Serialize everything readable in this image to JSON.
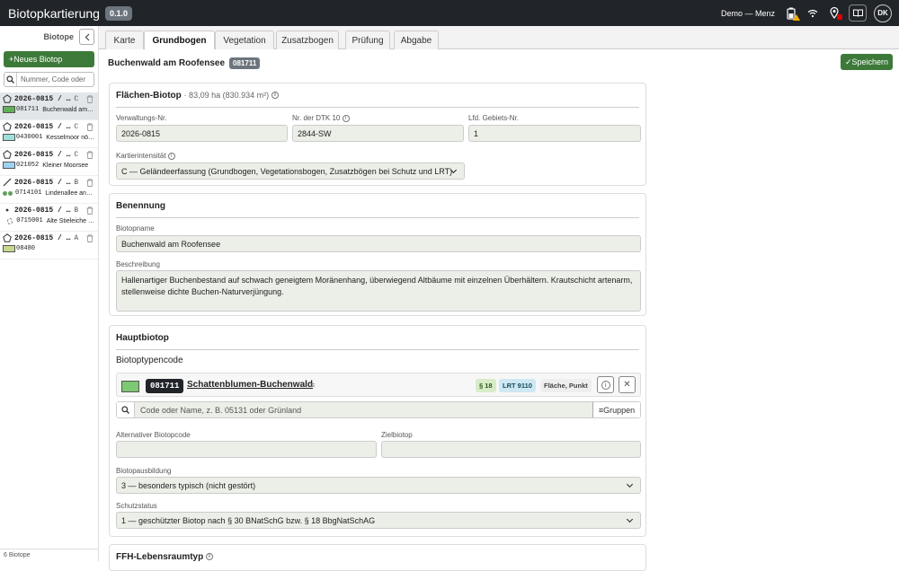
{
  "app": {
    "title": "Biotopkartierung",
    "version": "0.1.0",
    "user": "Demo — Menz",
    "avatar": "DK"
  },
  "sidebar": {
    "title": "Biotope",
    "new_button": "Neues Biotop",
    "search_placeholder": "Nummer, Code oder",
    "items": [
      {
        "id": "2026-0815 / …",
        "kind": "C",
        "code": "081711",
        "name": "Buchenwald am…",
        "swatch": "#62b05a",
        "shape": "polygon"
      },
      {
        "id": "2026-0815 / …",
        "kind": "C",
        "code": "0430001",
        "name": "Kesselmoor nö…",
        "swatch": "#9fe0d9",
        "shape": "polygon"
      },
      {
        "id": "2026-0815 / …",
        "kind": "C",
        "code": "021052",
        "name": "Kleiner Moorsee",
        "swatch": "#9fd2f0",
        "shape": "polygon"
      },
      {
        "id": "2026-0815 / …",
        "kind": "B",
        "code": "0714101",
        "name": "Lindenallee an…",
        "swatch": "#5fa05a",
        "shape": "line"
      },
      {
        "id": "2026-0815 / …",
        "kind": "B",
        "code": "0715001",
        "name": "Alte Stieleiche …",
        "swatch": "#ffffff",
        "shape": "point"
      },
      {
        "id": "2026-0815 / …",
        "kind": "A",
        "code": "08480",
        "name": "",
        "swatch": "#c6d88c",
        "shape": "polygon"
      }
    ],
    "count": "6 Biotope"
  },
  "tabs": [
    "Karte",
    "Grundbogen",
    "Vegetation",
    "Zusatzbogen",
    "Prüfung",
    "Abgabe"
  ],
  "header": {
    "name": "Buchenwald am Roofensee",
    "code": "081711",
    "save": "Speichern"
  },
  "flaechen": {
    "title": "Flächen-Biotop",
    "area": "· 83,09 ha (830.934 m²)",
    "verwaltung_label": "Verwaltungs-Nr.",
    "verwaltung": "2026-0815",
    "dtk_label": "Nr. der DTK 10",
    "dtk": "2844-SW",
    "lfd_label": "Lfd. Gebiets-Nr.",
    "lfd": "1",
    "intensitaet_label": "Kartierintensität",
    "intensitaet": "C — Geländeerfassung (Grundbogen, Vegetationsbogen, Zusatzbögen bei Schutz und LRT)"
  },
  "benennung": {
    "title": "Benennung",
    "name_label": "Biotopname",
    "name": "Buchenwald am Roofensee",
    "beschreibung_label": "Beschreibung",
    "beschreibung": "Hallenartiger Buchenbestand auf schwach geneigtem Moränenhang, überwiegend Altbäume mit einzelnen Überhältern. Krautschicht artenarm, stellenweise dichte Buchen-Naturverjüngung."
  },
  "hauptbiotop": {
    "title": "Hauptbiotop",
    "code_label": "Biotoptypencode",
    "code": "081711",
    "code_name": "Schattenblumen-Buchenwald",
    "tag1": "§ 18",
    "tag2": "LRT 9110",
    "tag3": "Fläche, Punkt",
    "search_placeholder": "Code oder Name, z. B. 05131 oder Grünland",
    "groups_button": "Gruppen",
    "alt_label": "Alternativer Biotopcode",
    "alt": "",
    "ziel_label": "Zielbiotop",
    "ziel": "",
    "auspraegung_label": "Biotopausbildung",
    "auspraegung": "3 — besonders typisch (nicht gestört)",
    "schutz_label": "Schutzstatus",
    "schutz": "1 — geschützter Biotop nach § 30 BNatSchG bzw. § 18 BbgNatSchAG"
  },
  "ffh": {
    "title": "FFH-Lebensraumtyp"
  },
  "colors": {
    "topbar": "#212529",
    "accent": "#3d7a3a",
    "field": "#ecefe8"
  }
}
